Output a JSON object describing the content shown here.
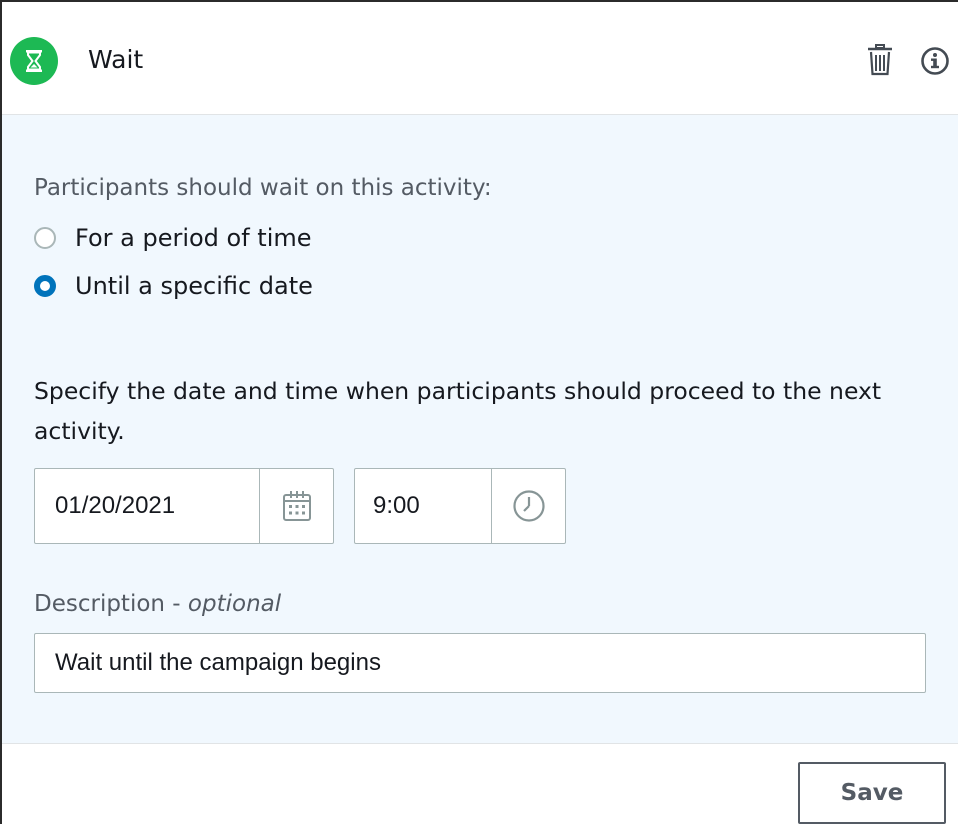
{
  "header": {
    "title": "Wait",
    "icon": "hourglass-icon",
    "icon_color": "#1db954",
    "actions": [
      "trash-icon",
      "info-icon"
    ]
  },
  "wait_mode": {
    "label": "Participants should wait on this activity:",
    "options": [
      {
        "label": "For a period of time",
        "selected": false
      },
      {
        "label": "Until a specific date",
        "selected": true
      }
    ]
  },
  "schedule": {
    "instruction": "Specify the date and time when participants should proceed to the next activity.",
    "date_value": "01/20/2021",
    "date_icon": "calendar-icon",
    "time_value": "9:00",
    "time_icon": "clock-icon"
  },
  "description": {
    "label": "Description - ",
    "label_optional": "optional",
    "value": "Wait until the campaign begins"
  },
  "footer": {
    "save_label": "Save"
  },
  "colors": {
    "accent": "#0073bb",
    "body_background": "#f1f8fe",
    "success": "#1db954"
  }
}
